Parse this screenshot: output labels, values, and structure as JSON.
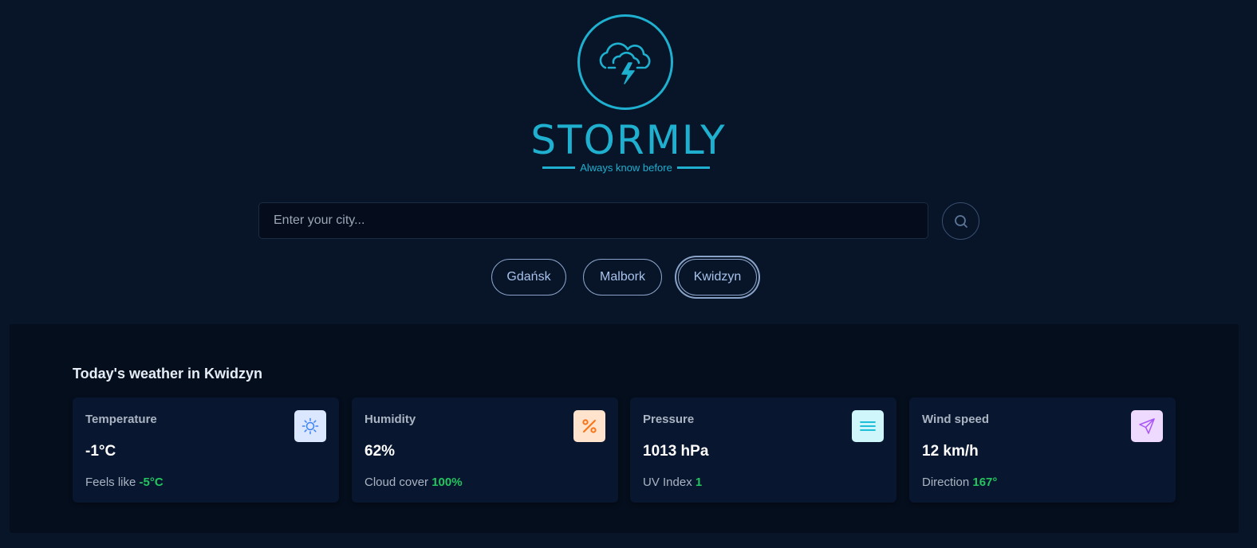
{
  "brand": {
    "name": "STORMLY",
    "tagline": "Always know before",
    "accent": "#1fb0d0",
    "logo_icon": "storm-cloud-icon"
  },
  "search": {
    "placeholder": "Enter your city...",
    "value": "",
    "button_icon": "search-icon"
  },
  "quick_cities": [
    {
      "label": "Gdańsk",
      "active": false
    },
    {
      "label": "Malbork",
      "active": false
    },
    {
      "label": "Kwidzyn",
      "active": true
    }
  ],
  "weather": {
    "title": "Today's weather in Kwidzyn",
    "cards": [
      {
        "label": "Temperature",
        "value": "-1°C",
        "sub_label": "Feels like",
        "sub_value": "-5°C",
        "icon": "sun-icon",
        "icon_bg": "#dbe7ff",
        "icon_color": "#3b82f6"
      },
      {
        "label": "Humidity",
        "value": "62%",
        "sub_label": "Cloud cover",
        "sub_value": "100%",
        "icon": "percent-icon",
        "icon_bg": "#ffe3cc",
        "icon_color": "#f97316"
      },
      {
        "label": "Pressure",
        "value": "1013 hPa",
        "sub_label": "UV Index",
        "sub_value": "1",
        "icon": "menu-lines-icon",
        "icon_bg": "#cff6fb",
        "icon_color": "#06b6d4"
      },
      {
        "label": "Wind speed",
        "value": "12 km/h",
        "sub_label": "Direction",
        "sub_value": "167°",
        "icon": "send-icon",
        "icon_bg": "#eed9ff",
        "icon_color": "#a855f7"
      }
    ],
    "highlight_color": "#22c55e"
  }
}
